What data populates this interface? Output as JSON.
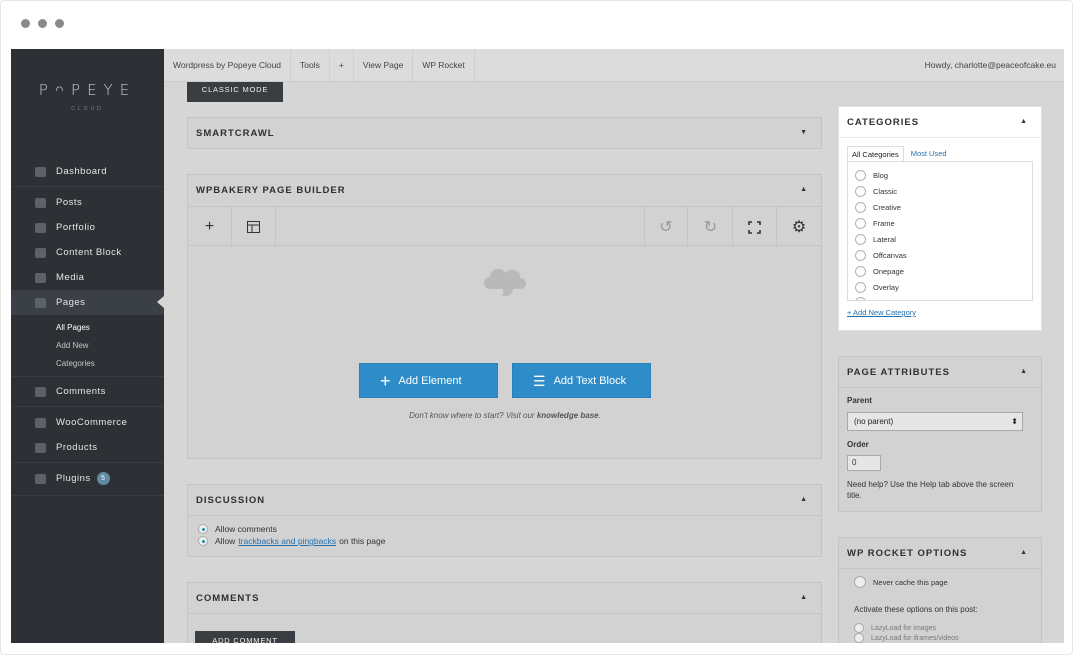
{
  "sidebar": {
    "brand": "PᴖPEYE",
    "brand_sub": "CLOUD",
    "items": [
      {
        "label": "Dashboard",
        "icon": "dashboard-icon"
      },
      {
        "label": "Posts",
        "icon": "pin-icon"
      },
      {
        "label": "Portfolio",
        "icon": "grid-icon"
      },
      {
        "label": "Content Block",
        "icon": "block-icon"
      },
      {
        "label": "Media",
        "icon": "media-icon"
      },
      {
        "label": "Pages",
        "icon": "pages-icon"
      },
      {
        "label": "Comments",
        "icon": "comment-icon"
      },
      {
        "label": "WooCommerce",
        "icon": "woocommerce-icon"
      },
      {
        "label": "Products",
        "icon": "box-icon"
      },
      {
        "label": "Plugins",
        "icon": "plug-icon"
      }
    ],
    "submenu": [
      "All Pages",
      "Add New",
      "Categories"
    ],
    "plugins_badge": "5"
  },
  "topbar": {
    "items": [
      "Wordpress by Popeye Cloud",
      "Tools",
      "+",
      "View Page",
      "WP Rocket"
    ],
    "howdy": "Howdy, charlotte@peaceofcake.eu"
  },
  "main": {
    "classic_mode": "CLASSIC MODE",
    "smartcrawl": "SMARTCRAWL",
    "wpbakery": "WPBAKERY PAGE BUILDER",
    "add_element": "Add Element",
    "add_text_block": "Add Text Block",
    "hint_before": "Don't know where to start? Visit our",
    "hint_link": "knowledge base",
    "hint_after": ".",
    "discussion": "DISCUSSION",
    "allow_comments": "Allow comments",
    "allow_prefix": "Allow",
    "trackbacks_link": "trackbacks and pingbacks",
    "allow_suffix": "on this page",
    "comments": "COMMENTS",
    "add_comment": "ADD COMMENT"
  },
  "categories": {
    "title": "CATEGORIES",
    "tab_all": "All Categories",
    "tab_most_used": "Most Used",
    "items": [
      "Blog",
      "Classic",
      "Creative",
      "Frame",
      "Lateral",
      "Offcanvas",
      "Onepage",
      "Overlay"
    ],
    "add_new": "+ Add New Category"
  },
  "page_attributes": {
    "title": "PAGE ATTRIBUTES",
    "parent_label": "Parent",
    "parent_value": "(no parent)",
    "order_label": "Order",
    "order_value": "0",
    "help": "Need help? Use the Help tab above the screen title."
  },
  "wp_rocket": {
    "title": "WP ROCKET OPTIONS",
    "never_cache": "Never cache this page",
    "activate": "Activate these options on this post:",
    "lazy_images": "LazyLoad for images",
    "lazy_iframes": "LazyLoad for iframes/videos"
  },
  "colors": {
    "sidebar_bg": "#2d3136",
    "accent_blue": "#2e8dc9",
    "overlay_gray": "#d6d6d6"
  }
}
